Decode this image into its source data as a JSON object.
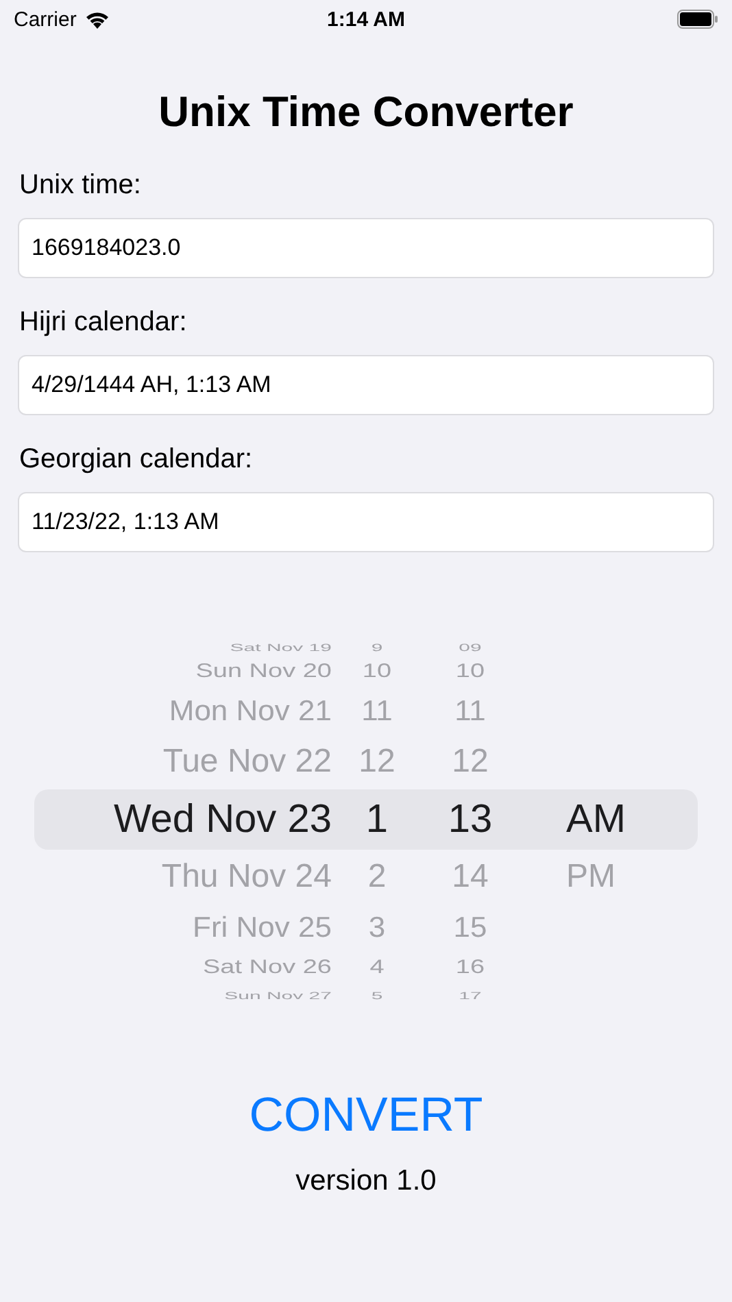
{
  "status_bar": {
    "carrier": "Carrier",
    "time": "1:14 AM"
  },
  "title": "Unix Time Converter",
  "fields": [
    {
      "label": "Unix time:",
      "value": "1669184023.0"
    },
    {
      "label": "Hijri calendar:",
      "value": "4/29/1444 AH, 1:13 AM"
    },
    {
      "label": "Georgian calendar:",
      "value": "11/23/22, 1:13 AM"
    }
  ],
  "picker": {
    "rows": [
      {
        "date": "Sat Nov 19",
        "hour": "9",
        "minute": "09",
        "selected": false
      },
      {
        "date": "Sun Nov 20",
        "hour": "10",
        "minute": "10",
        "selected": false
      },
      {
        "date": "Mon Nov 21",
        "hour": "11",
        "minute": "11",
        "selected": false
      },
      {
        "date": "Tue Nov 22",
        "hour": "12",
        "minute": "12",
        "selected": false
      },
      {
        "date": "Wed Nov 23",
        "hour": "1",
        "minute": "13",
        "selected": true
      },
      {
        "date": "Thu Nov 24",
        "hour": "2",
        "minute": "14",
        "selected": false
      },
      {
        "date": "Fri Nov 25",
        "hour": "3",
        "minute": "15",
        "selected": false
      },
      {
        "date": "Sat Nov 26",
        "hour": "4",
        "minute": "16",
        "selected": false
      },
      {
        "date": "Sun Nov 27",
        "hour": "5",
        "minute": "17",
        "selected": false
      }
    ],
    "periods": [
      {
        "label": "AM",
        "selected": true
      },
      {
        "label": "PM",
        "selected": false
      }
    ]
  },
  "convert_button": "CONVERT",
  "version": "version 1.0"
}
